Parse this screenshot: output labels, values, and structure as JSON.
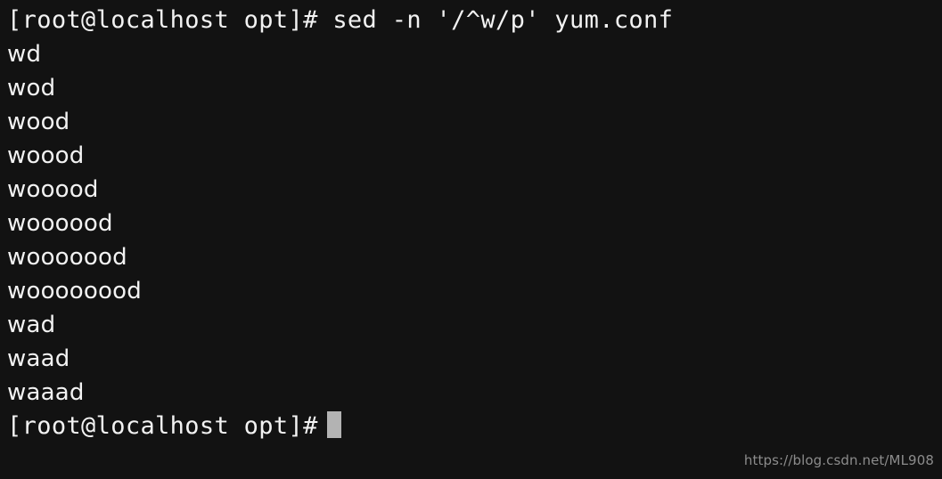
{
  "terminal": {
    "background_color": "#121212",
    "foreground_color": "#f2f2f2",
    "cursor_color": "#b3b3b3",
    "prompt": "[root@localhost opt]#",
    "command": " sed -n '/^w/p' yum.conf",
    "lines": [
      {
        "type": "prompt",
        "prompt": "[root@localhost opt]#",
        "command": " sed -n '/^w/p' yum.conf"
      },
      {
        "type": "output",
        "text": "wd"
      },
      {
        "type": "output",
        "text": "wod"
      },
      {
        "type": "output",
        "text": "wood"
      },
      {
        "type": "output",
        "text": "woood"
      },
      {
        "type": "output",
        "text": "wooood"
      },
      {
        "type": "output",
        "text": "woooood"
      },
      {
        "type": "output",
        "text": "wooooood"
      },
      {
        "type": "output",
        "text": "woooooood"
      },
      {
        "type": "output",
        "text": "wad"
      },
      {
        "type": "output",
        "text": "waad"
      },
      {
        "type": "output",
        "text": "waaad"
      },
      {
        "type": "prompt",
        "prompt": "[root@localhost opt]#",
        "command": ""
      }
    ]
  },
  "watermark": {
    "text": "https://blog.csdn.net/ML908",
    "color": "#8c8c8c"
  }
}
